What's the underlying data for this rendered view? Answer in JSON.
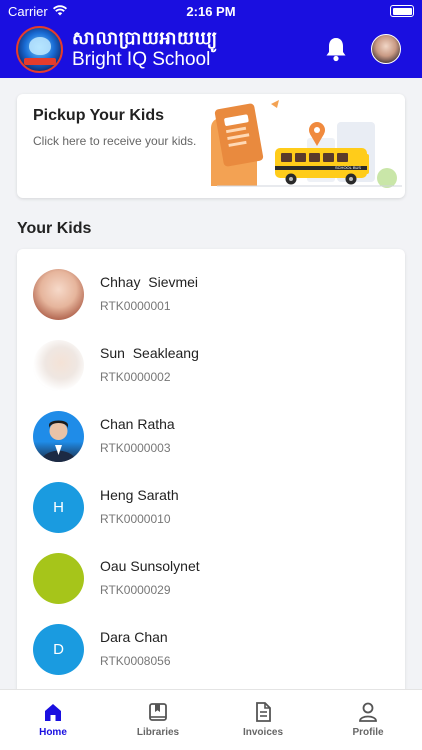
{
  "status_bar": {
    "carrier": "Carrier",
    "time": "2:16 PM"
  },
  "header": {
    "khmer_title": "សាលាប្រាយអាយឃ្យូ",
    "school_name": "Bright IQ School",
    "logo_icon": "school-logo-icon",
    "bell_icon": "bell-icon"
  },
  "pickup": {
    "title": "Pickup Your Kids",
    "subtitle": "Click here to receive your kids.",
    "bus_text": "SCHOOL BUS"
  },
  "kids_section": {
    "title": "Your Kids",
    "kids": [
      {
        "name": "Chhay  Sievmei",
        "id": "RTK0000001",
        "avatar": "photo"
      },
      {
        "name": "Sun  Seakleang",
        "id": "RTK0000002",
        "avatar": "photo"
      },
      {
        "name": "Chan Ratha",
        "id": "RTK0000003",
        "avatar": "photo"
      },
      {
        "name": "Heng Sarath",
        "id": "RTK0000010",
        "initial": "H",
        "avatar_color": "#1a9be0"
      },
      {
        "name": "Oau Sunsolynet",
        "id": "RTK0000029",
        "initial": "",
        "avatar_color": "#a6c51a"
      },
      {
        "name": "Dara Chan",
        "id": "RTK0008056",
        "initial": "D",
        "avatar_color": "#1a9be0"
      }
    ]
  },
  "nav": {
    "items": [
      {
        "label": "Home",
        "icon": "home-icon",
        "active": true
      },
      {
        "label": "Libraries",
        "icon": "library-icon"
      },
      {
        "label": "Invoices",
        "icon": "invoice-icon"
      },
      {
        "label": "Profile",
        "icon": "profile-icon"
      }
    ]
  },
  "colors": {
    "primary": "#1a0fe0",
    "background": "#f2f3f6",
    "accent_blue": "#1a9be0",
    "accent_green": "#a6c51a"
  }
}
